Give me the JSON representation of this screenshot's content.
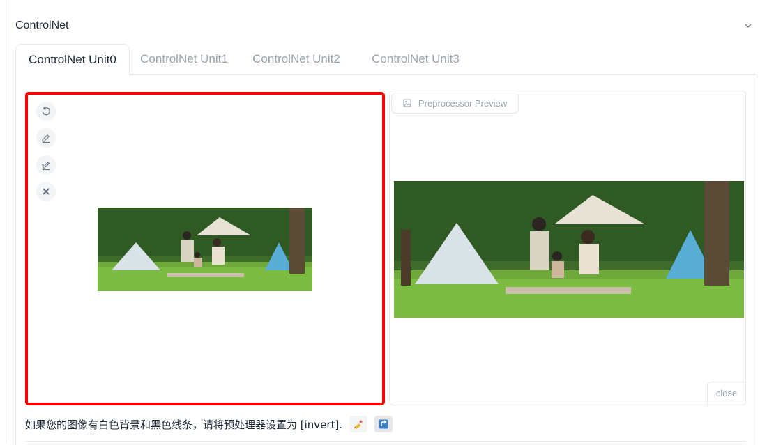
{
  "header": {
    "title": "ControlNet",
    "collapse_icon": "chevron-down-icon"
  },
  "tabs": [
    {
      "label": "ControlNet Unit0",
      "active": true
    },
    {
      "label": "ControlNet Unit1",
      "active": false
    },
    {
      "label": "ControlNet Unit2",
      "active": false
    },
    {
      "label": "ControlNet Unit3",
      "active": false
    }
  ],
  "image_editor": {
    "tools": [
      "undo-icon",
      "brush-icon",
      "clear-brush-icon",
      "remove-icon"
    ],
    "highlight_color": "#ff0000"
  },
  "preview": {
    "label": "Preprocessor Preview",
    "label_icon": "image-icon",
    "close_label": "close"
  },
  "hint": {
    "text": "如果您的图像有白色背景和黑色线条，请将预处理器设置为 [invert].",
    "buttons": [
      "edit-icon",
      "send-icon"
    ]
  }
}
